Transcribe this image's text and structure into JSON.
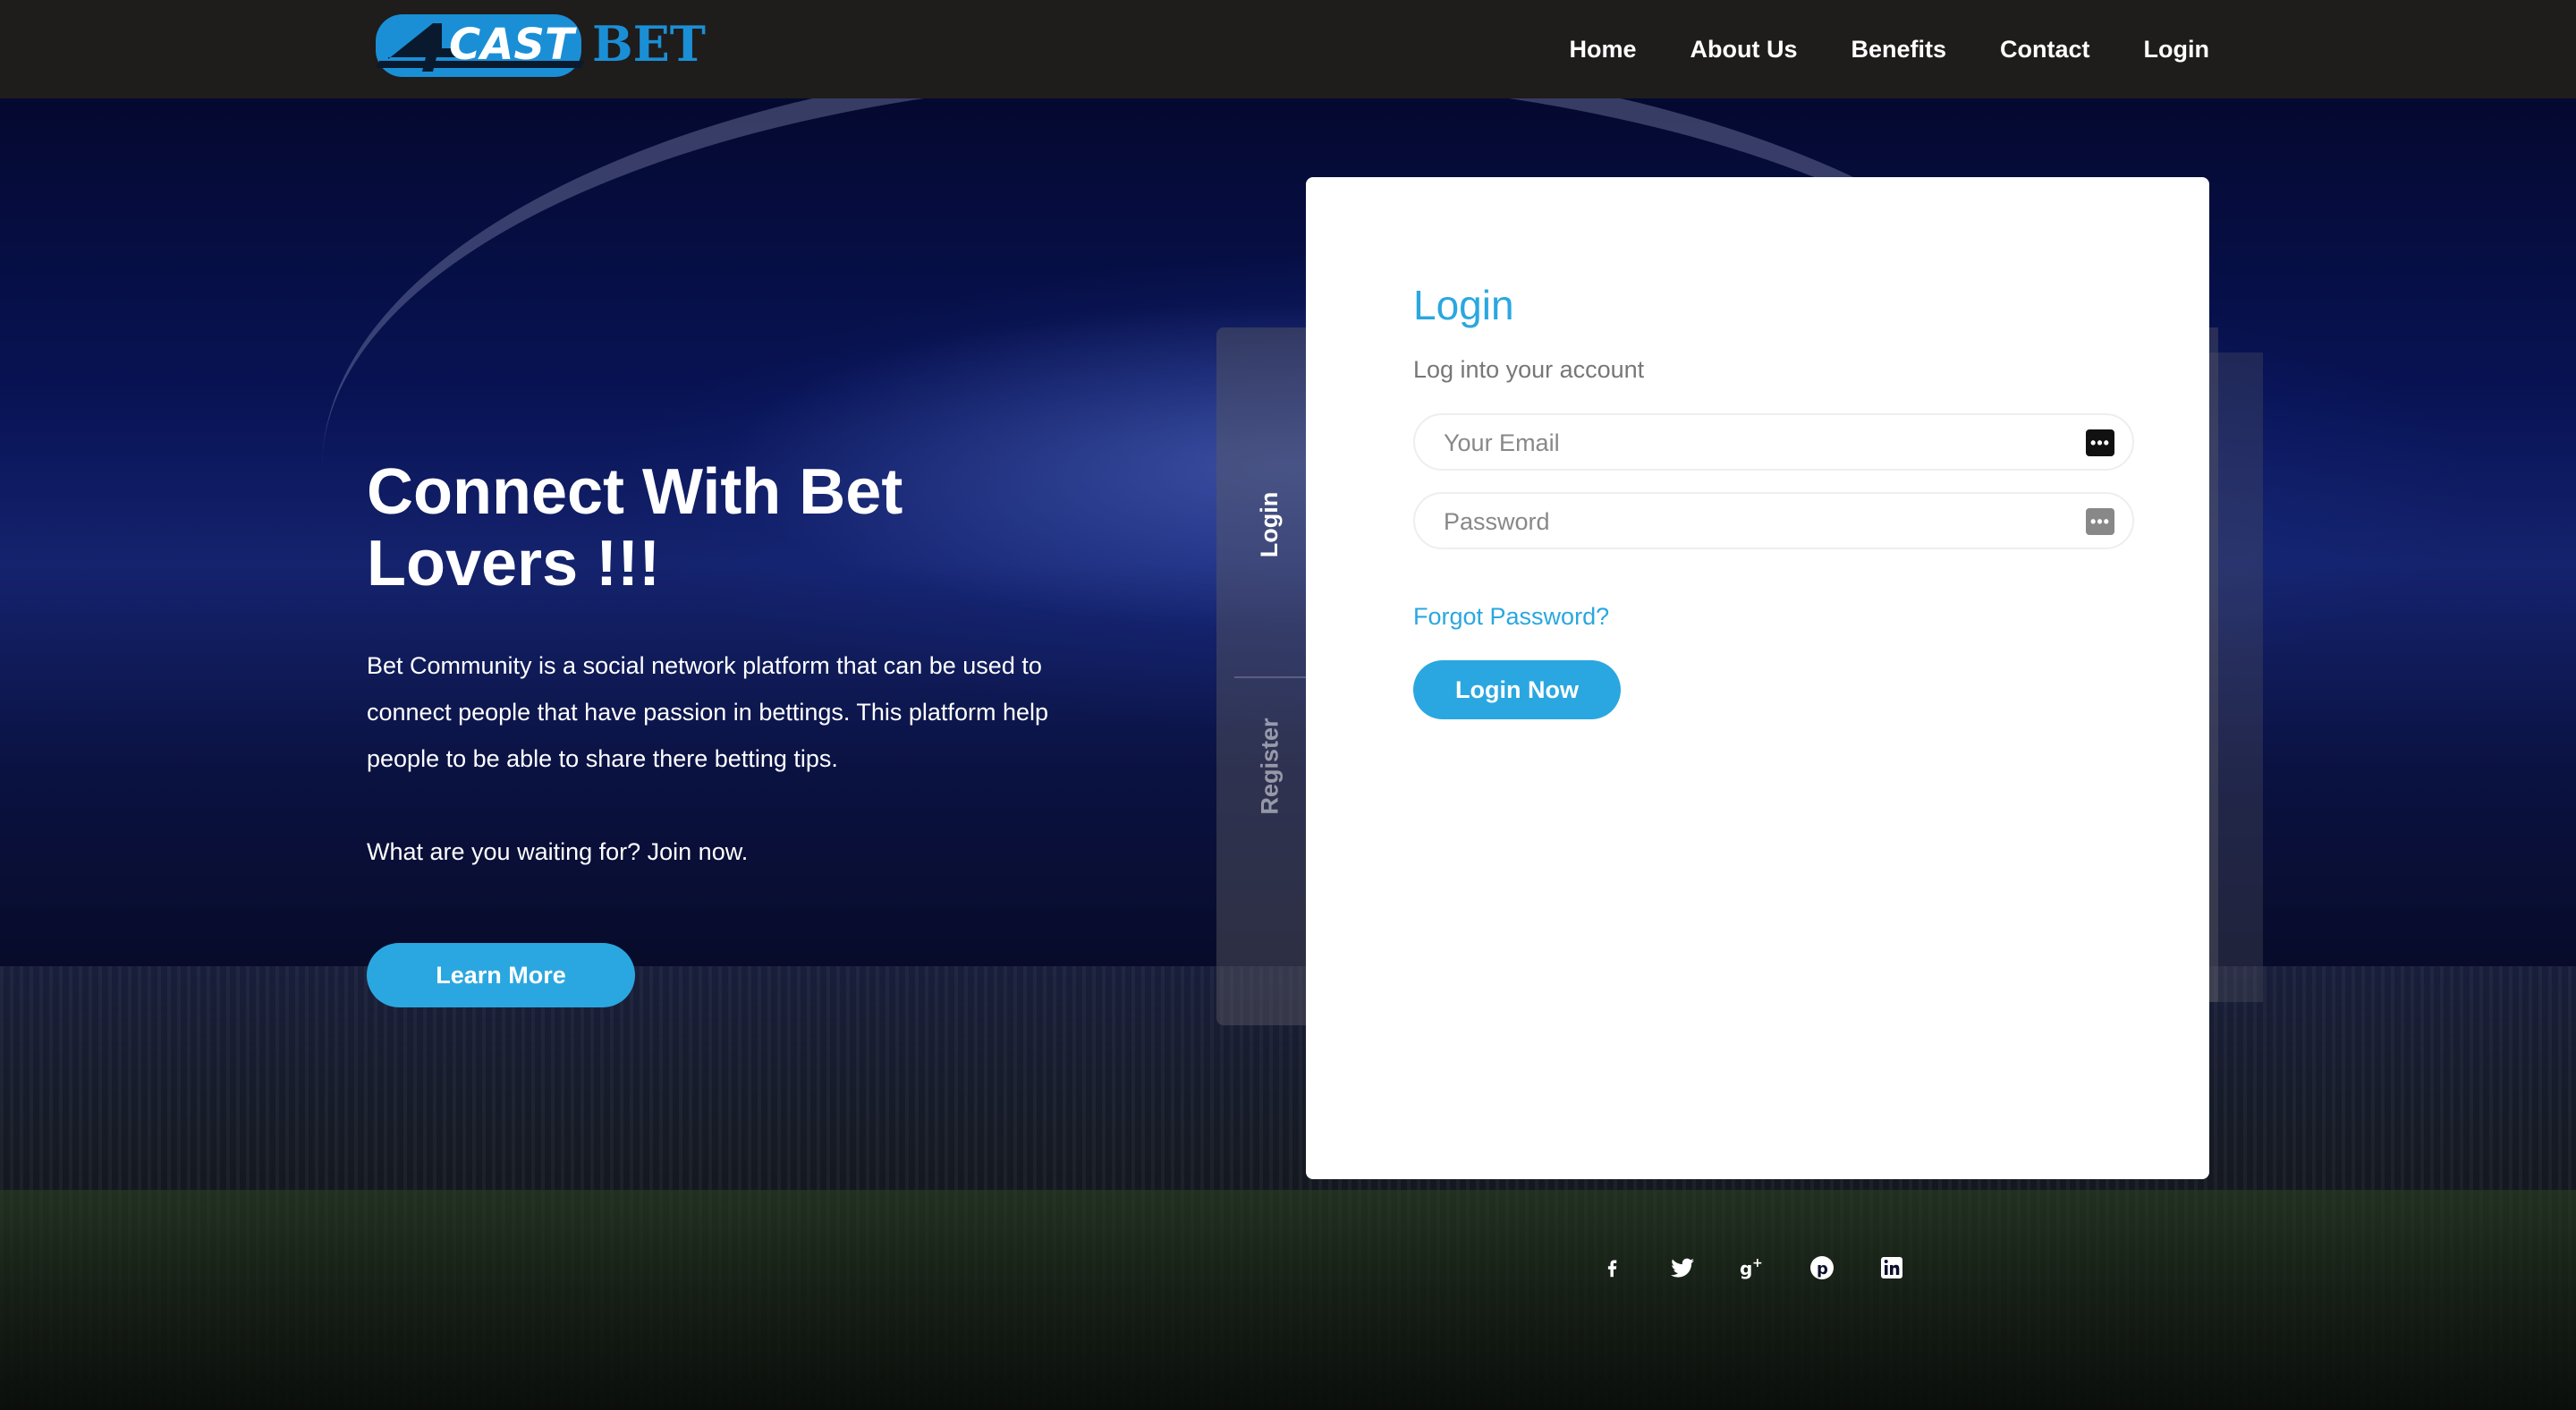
{
  "header": {
    "logo_alt": "4CASTBET",
    "nav": [
      {
        "label": "Home"
      },
      {
        "label": "About Us"
      },
      {
        "label": "Benefits"
      },
      {
        "label": "Contact"
      },
      {
        "label": "Login"
      }
    ]
  },
  "hero": {
    "title": "Connect With Bet Lovers !!!",
    "description": "Bet Community is a social network platform that can be used to connect people that have passion in bettings. This platform help people to be able to share there betting tips.",
    "cta_text": "What are you waiting for? Join now.",
    "learn_more_label": "Learn More"
  },
  "auth": {
    "tabs": [
      {
        "label": "Login",
        "active": true
      },
      {
        "label": "Register",
        "active": false
      }
    ],
    "title": "Login",
    "subtitle": "Log into your account",
    "email_placeholder": "Your Email",
    "password_placeholder": "Password",
    "forgot_label": "Forgot Password?",
    "submit_label": "Login Now"
  },
  "social": [
    {
      "icon": "facebook-icon"
    },
    {
      "icon": "twitter-icon"
    },
    {
      "icon": "google-plus-icon"
    },
    {
      "icon": "pinterest-icon"
    },
    {
      "icon": "linkedin-icon"
    }
  ],
  "colors": {
    "accent": "#2aa7e0",
    "header_bg": "#1f1c1c"
  }
}
